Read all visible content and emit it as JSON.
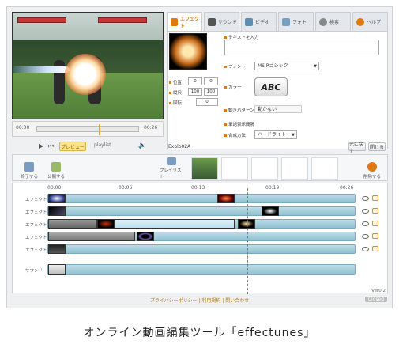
{
  "preview": {
    "time_start": "00:00",
    "time_end": "00:26",
    "preview_label": "プレビュー",
    "playlist_label": "playlist"
  },
  "tabs": [
    {
      "label": "エフェクト",
      "icon": "sparkle-icon",
      "active": true
    },
    {
      "label": "サウンド",
      "icon": "note-icon"
    },
    {
      "label": "ビデオ",
      "icon": "film-icon"
    },
    {
      "label": "フォト",
      "icon": "photo-icon"
    },
    {
      "label": "検索",
      "icon": "search-icon"
    },
    {
      "label": "ヘルプ",
      "icon": "help-icon"
    }
  ],
  "panel": {
    "text_label": "テキストを入力",
    "font_label": "フォント",
    "font_value": "MS Pゴシック",
    "color_label": "カラー",
    "color_sample": "ABC",
    "motion_label": "動きパターン",
    "motion_value": "動かない",
    "single_label": "単語表示間隔",
    "blend_label": "合成方法",
    "blend_value": "ハードライト",
    "pos_label": "位置",
    "pos_x": "0",
    "pos_y": "0",
    "scale_label": "縦尺",
    "scale_x": "100",
    "scale_y": "100",
    "rot_label": "回転",
    "rot_val": "0"
  },
  "namebar": {
    "name": "Explo02A",
    "revert": "元に戻す",
    "close": "閉じる"
  },
  "toolbar": {
    "exit": "終了する",
    "publish": "公開する",
    "playlist": "プレイリスト",
    "delete": "削除する"
  },
  "timeline": {
    "ticks": [
      "00:00",
      "00:06",
      "00:13",
      "00:19",
      "00:26"
    ],
    "tracks": [
      "エフェクト",
      "エフェクト",
      "エフェクト",
      "エフェクト",
      "エフェクト"
    ],
    "sound_label": "サウンド"
  },
  "version": "Ver0.2",
  "footer": {
    "privacy": "プライバシーポリシー",
    "terms": "利用規約",
    "contact": "問い合わせ",
    "closed": "Closed"
  },
  "caption": "オンライン動画編集ツール「effectunes」",
  "colors": {
    "accent": "#e07a0e",
    "track": "#92c1d2"
  }
}
